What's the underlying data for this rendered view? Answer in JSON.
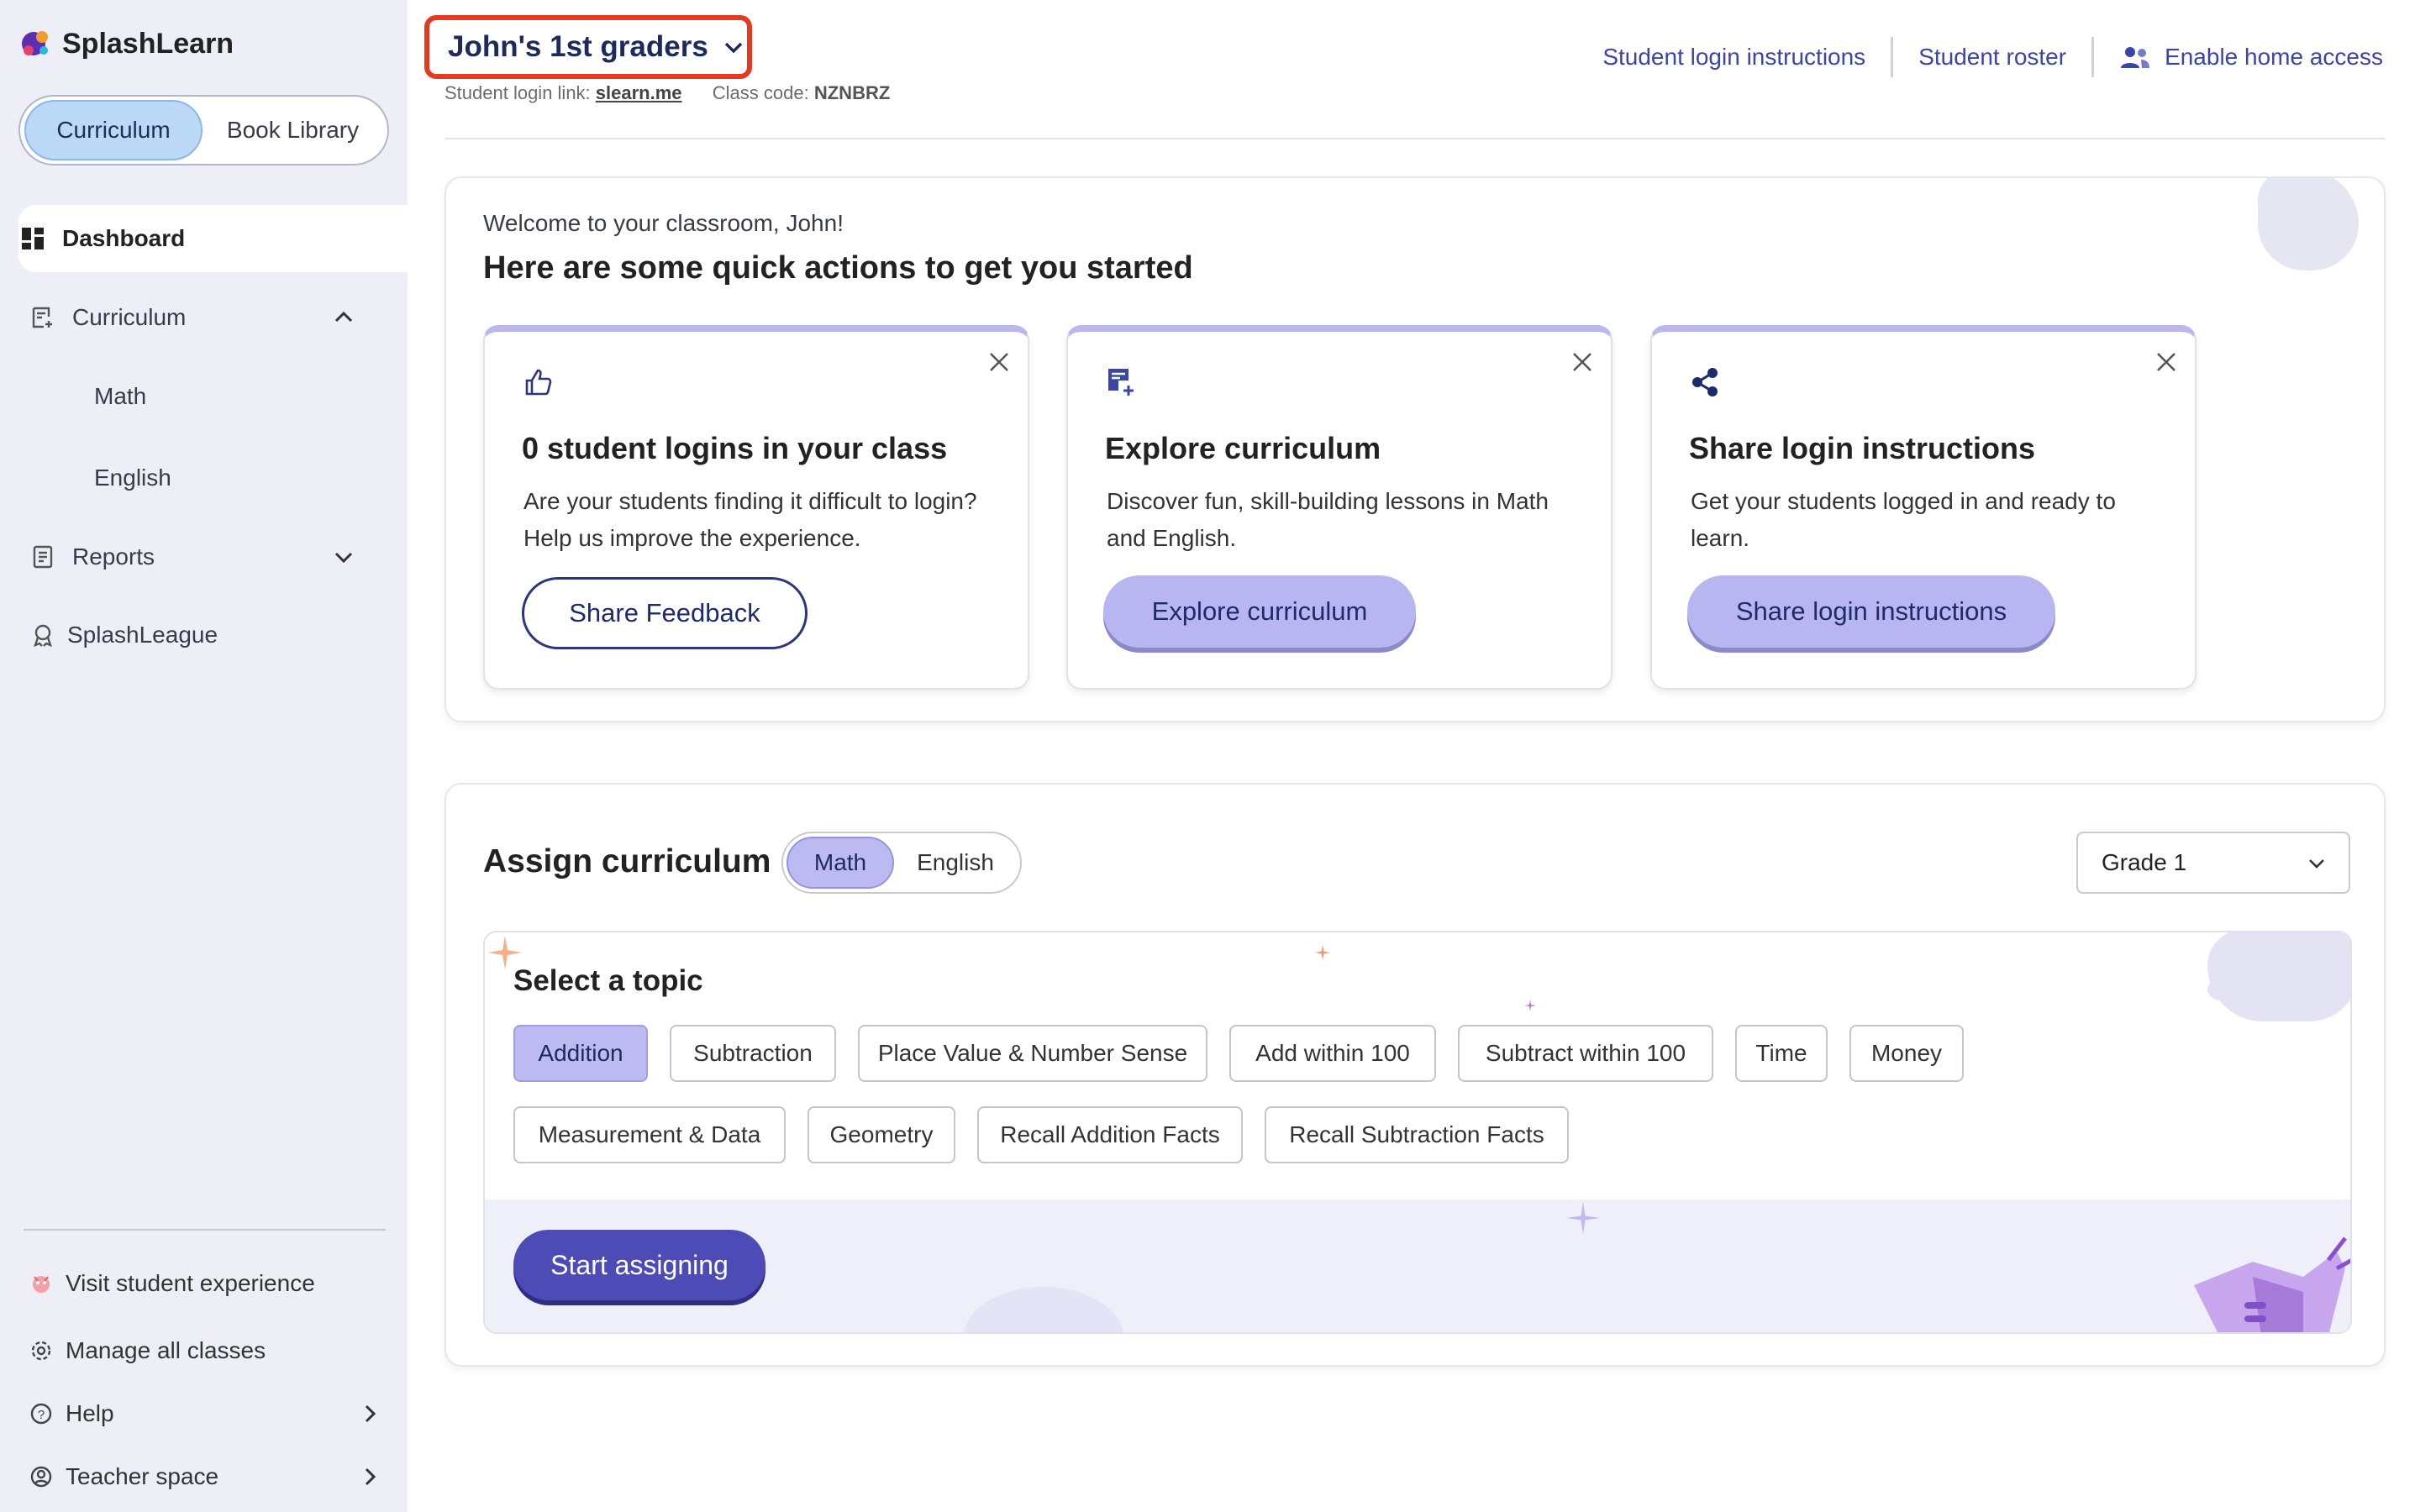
{
  "app": {
    "name": "SplashLearn"
  },
  "sidebar": {
    "toggle": {
      "active": "Curriculum",
      "inactive": "Book Library"
    },
    "nav": {
      "dashboard": "Dashboard",
      "curriculum": "Curriculum",
      "math": "Math",
      "english": "English",
      "reports": "Reports",
      "splashleague": "SplashLeague"
    },
    "bottom": {
      "visit": "Visit student experience",
      "manage": "Manage all classes",
      "help": "Help",
      "teacher": "Teacher space"
    }
  },
  "header": {
    "class_name": "John's 1st graders",
    "login_link_label": "Student login link:",
    "login_link": "slearn.me",
    "class_code_label": "Class code:",
    "class_code": "NZNBRZ",
    "links": {
      "instructions": "Student login instructions",
      "roster": "Student roster",
      "home": "Enable home access"
    }
  },
  "quick_actions": {
    "welcome": "Welcome to your classroom, John!",
    "title": "Here are some quick actions to get you started",
    "cards": [
      {
        "title": "0 student logins in your class",
        "text": "Are your students finding it difficult to login? Help us improve the experience.",
        "button": "Share Feedback"
      },
      {
        "title": "Explore curriculum",
        "text": "Discover fun, skill-building lessons in Math and English.",
        "button": "Explore curriculum"
      },
      {
        "title": "Share login instructions",
        "text": "Get your students logged in and ready to learn.",
        "button": "Share login instructions"
      }
    ]
  },
  "assign": {
    "title": "Assign curriculum",
    "subjects": {
      "active": "Math",
      "inactive": "English"
    },
    "grade": "Grade 1",
    "topic_title": "Select a topic",
    "topics": [
      "Addition",
      "Subtraction",
      "Place Value & Number Sense",
      "Add within 100",
      "Subtract within 100",
      "Time",
      "Money",
      "Measurement & Data",
      "Geometry",
      "Recall Addition Facts",
      "Recall Subtraction Facts"
    ],
    "selected_topic": "Addition",
    "start_button": "Start assigning"
  },
  "colors": {
    "accent": "#4d4bb5",
    "highlight": "#e53a1f",
    "chip_selected": "#bcbaf0",
    "sidebar_bg": "#eeeff6"
  }
}
